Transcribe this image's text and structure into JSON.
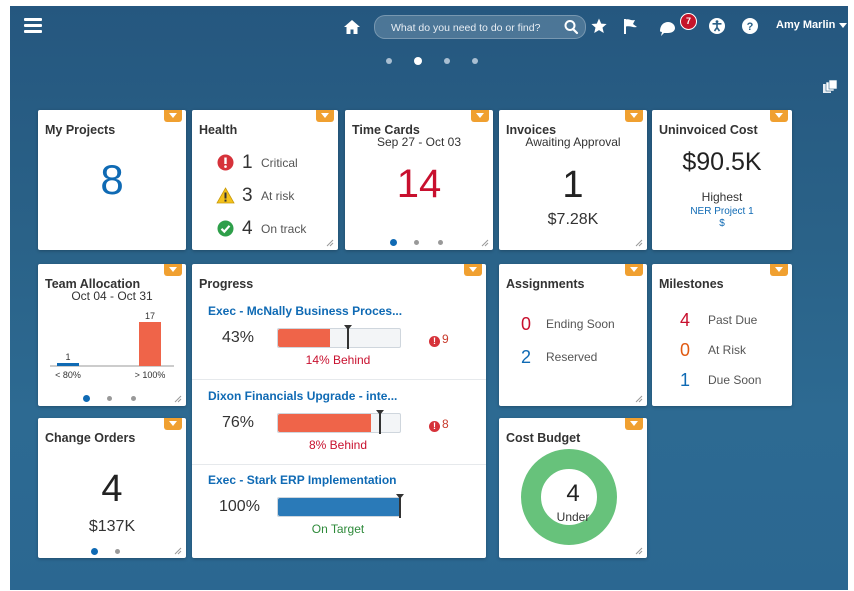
{
  "header": {
    "search_placeholder": "What do you need to do or find?",
    "notifications_count": "7",
    "user_name": "Amy Marlin"
  },
  "my_projects": {
    "title": "My Projects",
    "value": "8"
  },
  "health": {
    "title": "Health",
    "rows": [
      {
        "count": "1",
        "label": "Critical"
      },
      {
        "count": "3",
        "label": "At risk"
      },
      {
        "count": "4",
        "label": "On track"
      }
    ]
  },
  "time_cards": {
    "title": "Time Cards",
    "range": "Sep 27 - Oct 03",
    "value": "14"
  },
  "invoices": {
    "title": "Invoices",
    "subtitle": "Awaiting Approval",
    "count": "1",
    "amount": "$7.28K"
  },
  "uninvoiced": {
    "title": "Uninvoiced Cost",
    "amount": "$90.5K",
    "highest_label": "Highest",
    "project": "NER Project 1",
    "currency": "$"
  },
  "team_allocation": {
    "title": "Team Allocation",
    "range": "Oct 04 - Oct 31",
    "chart_data": {
      "type": "bar",
      "categories": [
        "< 80%",
        "> 100%"
      ],
      "values": [
        1,
        17
      ],
      "title": "",
      "xlabel": "",
      "ylabel": ""
    }
  },
  "progress": {
    "title": "Progress",
    "items": [
      {
        "name": "Exec - McNally Business Proces...",
        "pct_label": "43%",
        "fraction": 0.43,
        "target": 0.57,
        "status": "14% Behind",
        "alerts": "9"
      },
      {
        "name": "Dixon Financials Upgrade - inte...",
        "pct_label": "76%",
        "fraction": 0.76,
        "target": 0.84,
        "status": "8% Behind",
        "alerts": "8"
      },
      {
        "name": "Exec - Stark ERP Implementation",
        "pct_label": "100%",
        "fraction": 1.0,
        "target": 1.0,
        "status": "On Target",
        "alerts": ""
      }
    ]
  },
  "assignments": {
    "title": "Assignments",
    "rows": [
      {
        "count": "0",
        "label": "Ending Soon"
      },
      {
        "count": "2",
        "label": "Reserved"
      }
    ]
  },
  "milestones": {
    "title": "Milestones",
    "rows": [
      {
        "count": "4",
        "label": "Past Due"
      },
      {
        "count": "0",
        "label": "At Risk"
      },
      {
        "count": "1",
        "label": "Due Soon"
      }
    ]
  },
  "change_orders": {
    "title": "Change Orders",
    "count": "4",
    "amount": "$137K"
  },
  "cost_budget": {
    "title": "Cost Budget",
    "value": "4",
    "label": "Under"
  },
  "colors": {
    "accent_blue": "#0f6ab4",
    "red": "#c8102e",
    "orange": "#f0a030",
    "bar_red": "#ef6449",
    "bar_blue": "#2a7ab8",
    "green": "#67c27b"
  }
}
